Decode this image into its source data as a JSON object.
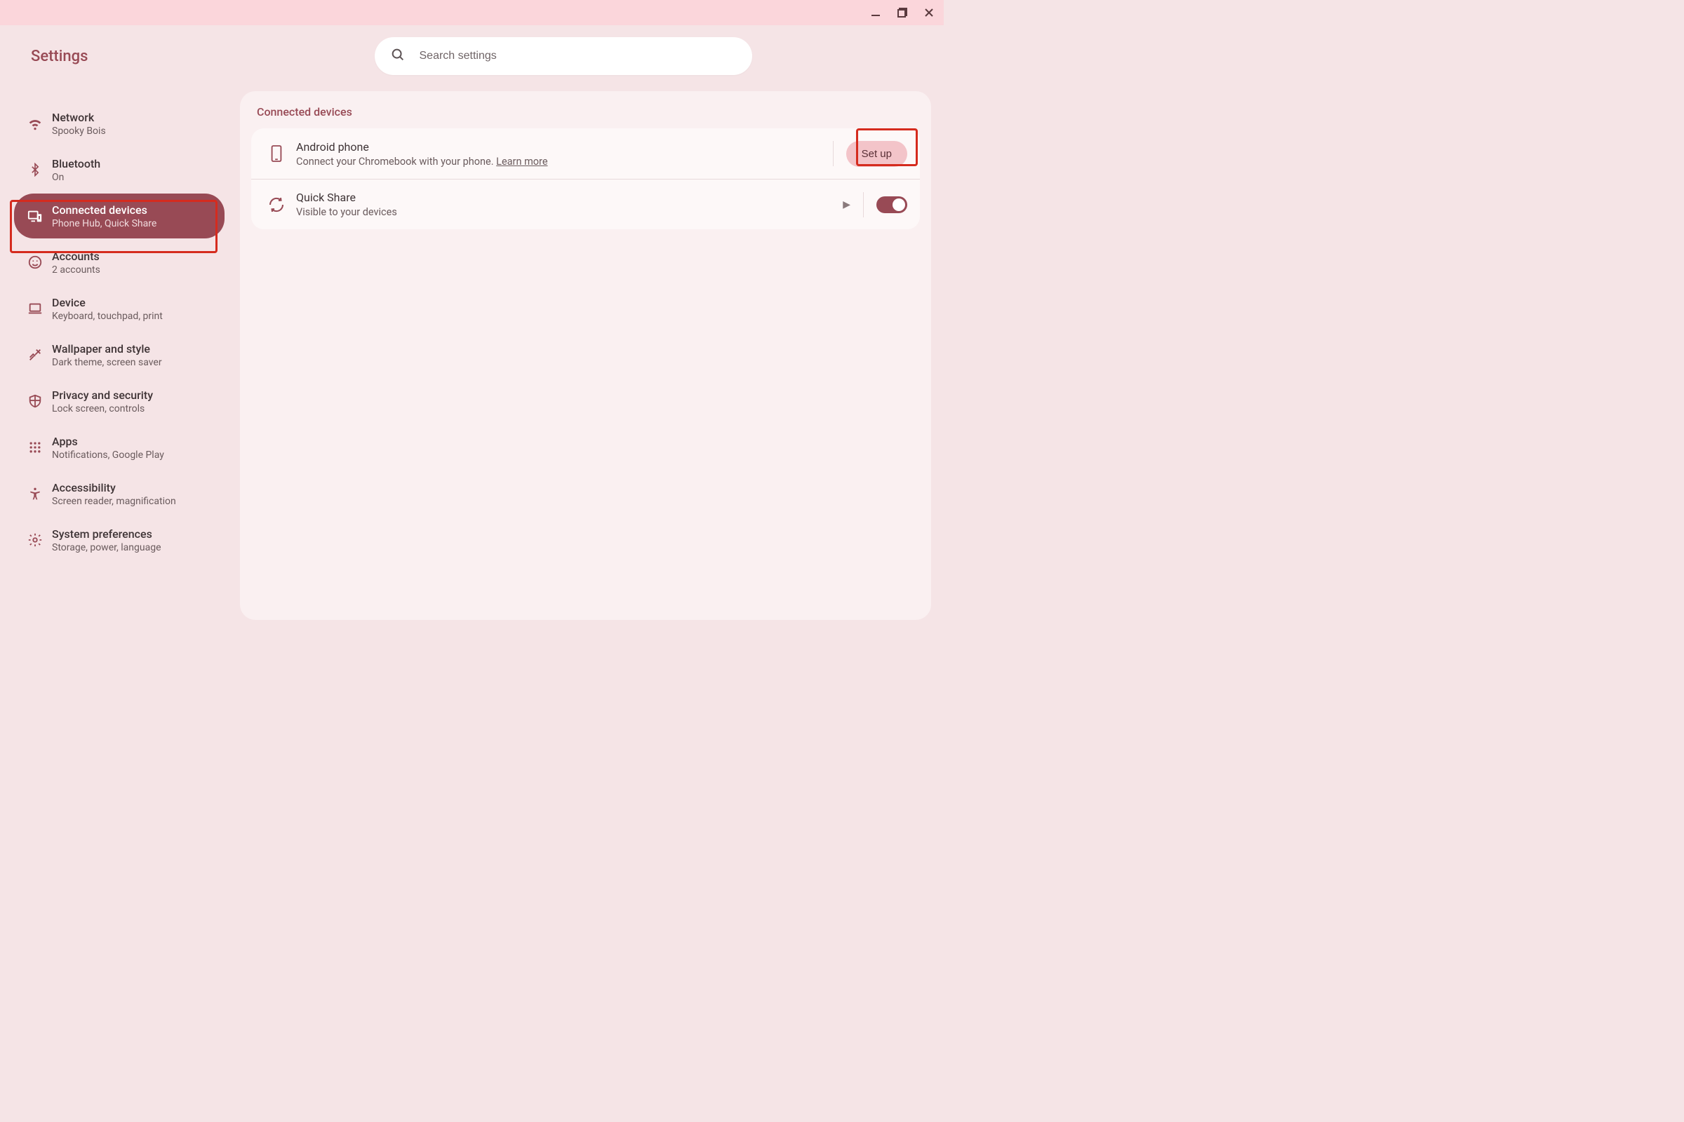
{
  "window": {
    "title": "Settings"
  },
  "search": {
    "placeholder": "Search settings"
  },
  "sidebar": {
    "items": [
      {
        "id": "network",
        "label": "Network",
        "sub": "Spooky Bois"
      },
      {
        "id": "bluetooth",
        "label": "Bluetooth",
        "sub": "On"
      },
      {
        "id": "connected-devices",
        "label": "Connected devices",
        "sub": "Phone Hub, Quick Share",
        "active": true
      },
      {
        "id": "accounts",
        "label": "Accounts",
        "sub": "2 accounts"
      },
      {
        "id": "device",
        "label": "Device",
        "sub": "Keyboard, touchpad, print"
      },
      {
        "id": "wallpaper",
        "label": "Wallpaper and style",
        "sub": "Dark theme, screen saver"
      },
      {
        "id": "privacy",
        "label": "Privacy and security",
        "sub": "Lock screen, controls"
      },
      {
        "id": "apps",
        "label": "Apps",
        "sub": "Notifications, Google Play"
      },
      {
        "id": "accessibility",
        "label": "Accessibility",
        "sub": "Screen reader, magnification"
      },
      {
        "id": "system",
        "label": "System preferences",
        "sub": "Storage, power, language"
      }
    ]
  },
  "main": {
    "heading": "Connected devices",
    "android": {
      "title": "Android phone",
      "desc_prefix": "Connect your Chromebook with your phone. ",
      "learn_more": "Learn more",
      "button": "Set up"
    },
    "quickshare": {
      "title": "Quick Share",
      "sub": "Visible to your devices",
      "toggle_on": true
    }
  },
  "colors": {
    "highlight": "#d52b1e"
  }
}
